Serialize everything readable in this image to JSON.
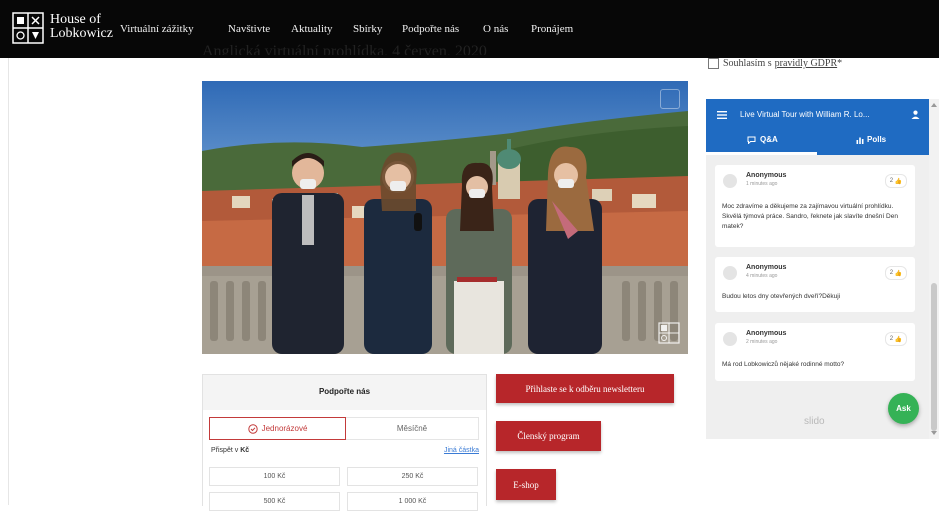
{
  "brand": {
    "line1": "House of",
    "line2": "Lobkowicz"
  },
  "nav": [
    {
      "label": "Virtuální zážitky"
    },
    {
      "label": "Navštivte"
    },
    {
      "label": "Aktuality"
    },
    {
      "label": "Sbírky"
    },
    {
      "label": "Podpořte nás"
    },
    {
      "label": "O nás"
    },
    {
      "label": "Pronájem"
    }
  ],
  "heading_partial": "Anglická virtuální prohlídka, 4 červen, 2020",
  "video": {
    "watermark": "Lobkowicz seal"
  },
  "donate": {
    "title": "Podpořte nás",
    "once_label": "Jednorázové",
    "monthly_label": "Měsíčně",
    "contrib_prefix": "Přispět v",
    "currency": "Kč",
    "other_amount": "Jiná částka",
    "amounts": [
      "100 Kč",
      "250 Kč",
      "500 Kč",
      "1 000 Kč"
    ]
  },
  "buttons": {
    "newsletter": "Přihlaste se k odběru newsletteru",
    "membership": "Členský program",
    "eshop": "E-shop"
  },
  "gdpr": {
    "prefix": "Souhlasím s",
    "link": "pravidly GDPR",
    "suffix": "*"
  },
  "slido": {
    "title": "Live Virtual Tour with William R. Lo...",
    "tab_qa": "Q&A",
    "tab_polls": "Polls",
    "questions": [
      {
        "name": "Anonymous",
        "time": "1 minutes ago",
        "likes": "2",
        "text": "Moc zdravíme a děkujeme za zajímavou virtuální prohlídku. Skvělá týmová práce. Sandro, řeknete jak slavíte dnešní Den matek?"
      },
      {
        "name": "Anonymous",
        "time": "4 minutes ago",
        "likes": "2",
        "text": "Budou letos dny otevřených dveří?Děkuji"
      },
      {
        "name": "Anonymous",
        "time": "2 minutes ago",
        "likes": "2",
        "text": "Má rod Lobkowiczů nějaké rodinné motto?"
      }
    ],
    "logo": "slido",
    "ask_label": "Ask"
  },
  "colors": {
    "nav_bg": "#070707",
    "brand_red": "#b7262a",
    "slido_blue": "#1f6bc2",
    "ask_green": "#35b256"
  }
}
